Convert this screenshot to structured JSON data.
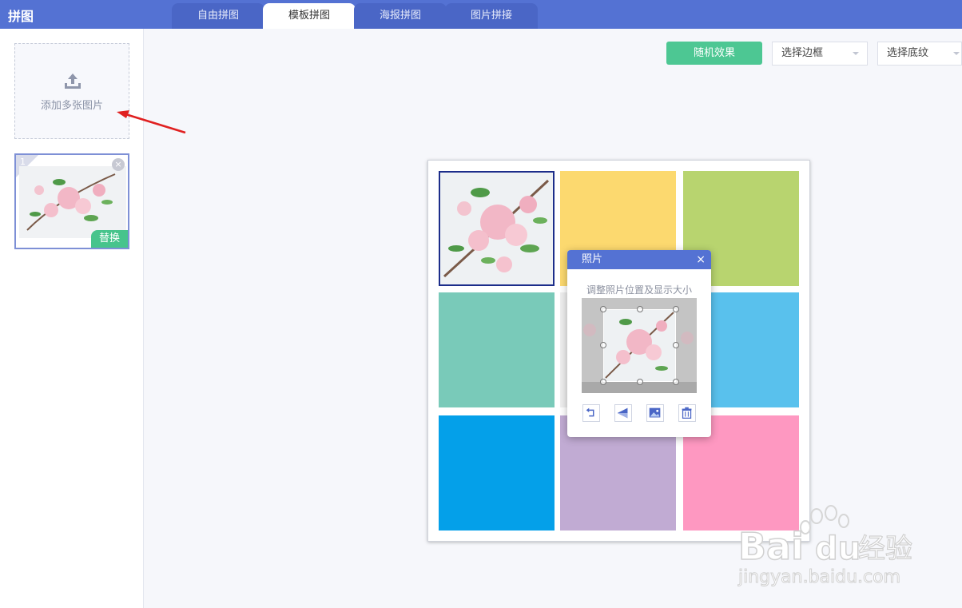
{
  "app": {
    "title": "拼图"
  },
  "tabs": [
    {
      "label": "自由拼图",
      "active": false
    },
    {
      "label": "模板拼图",
      "active": true
    },
    {
      "label": "海报拼图",
      "active": false
    },
    {
      "label": "图片拼接",
      "active": false
    }
  ],
  "sidebar": {
    "add_label": "添加多张图片",
    "thumb": {
      "index": "1",
      "close": "×",
      "replace_label": "替换"
    }
  },
  "toolbar": {
    "random_label": "随机效果",
    "border_select": "选择边框",
    "texture_select": "选择底纹"
  },
  "canvas": {
    "cells": [
      {
        "type": "photo",
        "color": ""
      },
      {
        "type": "color",
        "color": "#fcd96f"
      },
      {
        "type": "color",
        "color": "#b8d46f"
      },
      {
        "type": "color",
        "color": "#79cab9"
      },
      {
        "type": "color",
        "color": "#eeeeee"
      },
      {
        "type": "color",
        "color": "#59c1ed"
      },
      {
        "type": "color",
        "color": "#04a0e9"
      },
      {
        "type": "color",
        "color": "#c1abd3"
      },
      {
        "type": "color",
        "color": "#fe98c1"
      }
    ]
  },
  "popup": {
    "title": "照片",
    "close": "×",
    "hint": "调整照片位置及显示大小",
    "tools": [
      "rotate-icon",
      "flip-icon",
      "image-icon",
      "delete-icon"
    ]
  },
  "watermark": {
    "brand": "Baidu经验",
    "url": "jingyan.baidu.com"
  },
  "colors": {
    "accent": "#5472d3",
    "green": "#4dc793",
    "selected_border": "#1c2d8a"
  }
}
